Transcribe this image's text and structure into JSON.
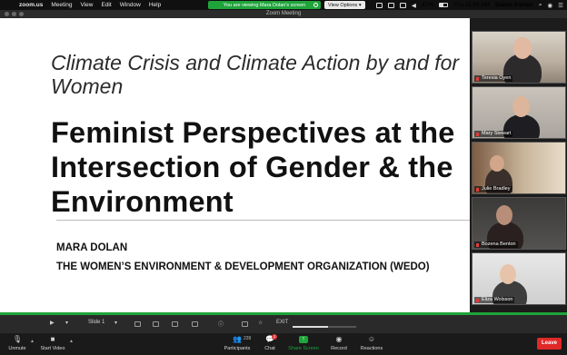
{
  "menubar": {
    "apple_icon": "apple-icon",
    "app_name": "zoom.us",
    "menus": [
      "Meeting",
      "View",
      "Edit",
      "Window",
      "Help"
    ],
    "share_banner": "You are viewing Mara Dolan's screen",
    "view_options": "View Options",
    "battery": "47%",
    "clock": "Thu 11:58 AM",
    "user": "Dallas Karren"
  },
  "window": {
    "title": "Zoom Meeting"
  },
  "slide": {
    "subtitle": "Climate Crisis and Climate Action by and for Women",
    "title": "Feminist Perspectives at the\nIntersection of Gender & the\nEnvironment",
    "speaker": "MARA DOLAN",
    "organization": "THE WOMEN’S ENVIRONMENT & DEVELOPMENT ORGANIZATION (WEDO)"
  },
  "participants": [
    {
      "name": "Teresia Oyen",
      "muted": true
    },
    {
      "name": "Mary Stewart",
      "muted": true
    },
    {
      "name": "Julie Bradley",
      "muted": true
    },
    {
      "name": "Bozena Benton",
      "muted": true
    },
    {
      "name": "Eliza Wolsson",
      "muted": true
    }
  ],
  "presenter_bar": {
    "slide_label": "Slide 1",
    "exit_label": "EXIT",
    "progress": 0.55
  },
  "toolbar": {
    "unmute": "Unmute",
    "start_video": "Start Video",
    "participants": "Participants",
    "participant_count": "239",
    "chat": "Chat",
    "chat_badge": "2",
    "share_screen": "Share Screen",
    "record": "Record",
    "reactions": "Reactions",
    "leave": "Leave"
  },
  "colors": {
    "share_green": "#1fa43b",
    "leave_red": "#e02828",
    "slide_bg": "#ffffff"
  }
}
